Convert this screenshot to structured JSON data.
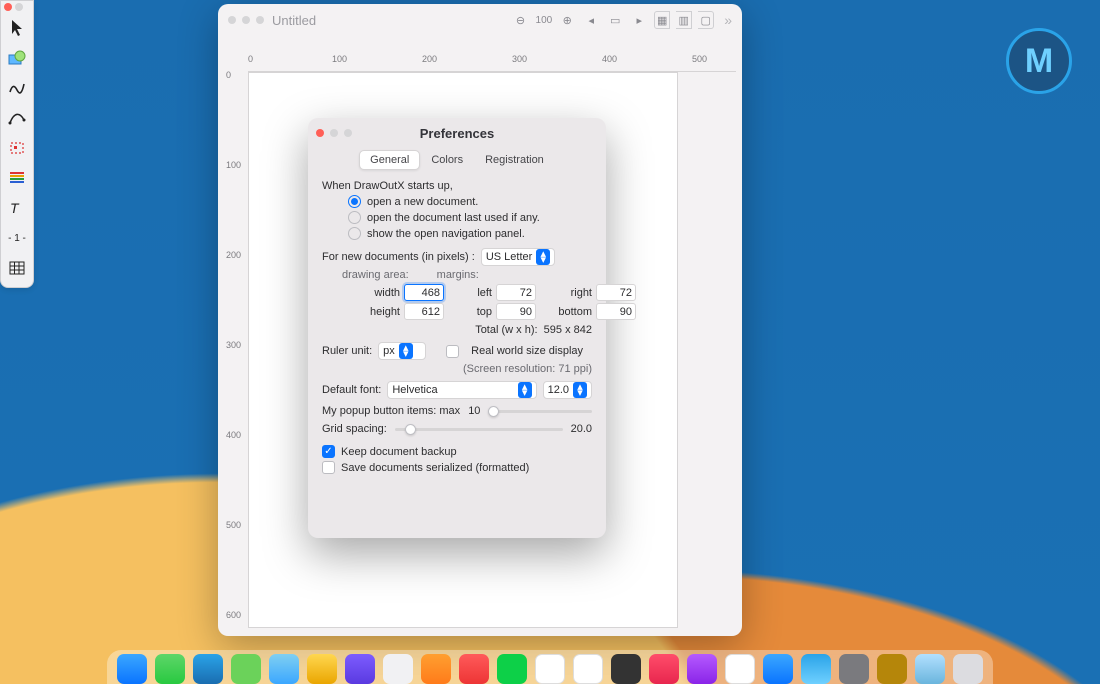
{
  "wallpaper": {
    "name": "macOS Big Sur"
  },
  "logo": {
    "letter": "M"
  },
  "tool_palette": {
    "tools": [
      {
        "name": "pointer"
      },
      {
        "name": "shape"
      },
      {
        "name": "freehand"
      },
      {
        "name": "curve"
      },
      {
        "name": "crop"
      },
      {
        "name": "lines-style"
      },
      {
        "name": "text"
      },
      {
        "name": "measure"
      },
      {
        "name": "grid"
      }
    ],
    "measure_label": "- 1 -"
  },
  "document_window": {
    "title": "Untitled",
    "zoom": "100",
    "ruler_h_ticks": [
      "0",
      "100",
      "200",
      "300",
      "400",
      "500"
    ],
    "ruler_v_ticks": [
      "0",
      "100",
      "200",
      "300",
      "400",
      "500",
      "600"
    ]
  },
  "preferences": {
    "title": "Preferences",
    "tabs": {
      "general": "General",
      "colors": "Colors",
      "registration": "Registration"
    },
    "active_tab": "general",
    "startup_label": "When DrawOutX starts up,",
    "startup_options": {
      "open_new": "open a new document.",
      "open_last": "open the document last used if any.",
      "show_nav": "show the open navigation panel."
    },
    "startup_selected": "open_new",
    "new_doc_label": "For new documents (in pixels) :",
    "paper_size_value": "US Letter",
    "drawing_area_label": "drawing area:",
    "margins_label": "margins:",
    "width_label": "width",
    "width_value": "468",
    "height_label": "height",
    "height_value": "612",
    "left_label": "left",
    "left_value": "72",
    "top_label": "top",
    "top_value": "90",
    "right_label": "right",
    "right_value": "72",
    "bottom_label": "bottom",
    "bottom_value": "90",
    "total_label": "Total (w x h):",
    "total_value": "595 x 842",
    "ruler_unit_label": "Ruler unit:",
    "ruler_unit_value": "px",
    "real_world_label": "Real world size display",
    "screen_res_label": "(Screen resolution: 71 ppi)",
    "default_font_label": "Default font:",
    "default_font_value": "Helvetica",
    "default_font_size": "12.0",
    "popup_max_label": "My popup button items: max",
    "popup_max_value": "10",
    "grid_spacing_label": "Grid spacing:",
    "grid_spacing_value": "20.0",
    "keep_backup_label": "Keep document backup",
    "keep_backup_checked": true,
    "save_serialized_label": "Save documents serialized (formatted)",
    "save_serialized_checked": false
  }
}
